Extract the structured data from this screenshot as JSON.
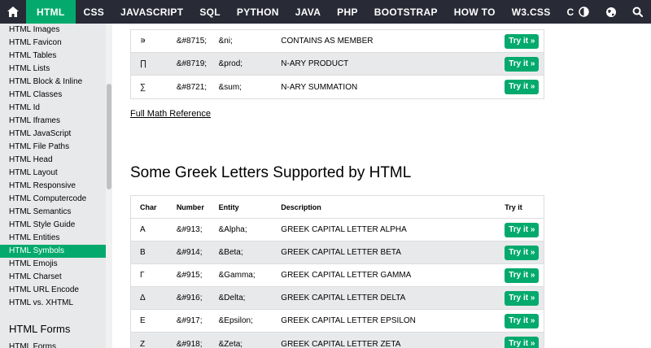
{
  "nav": {
    "items": [
      "HTML",
      "CSS",
      "JAVASCRIPT",
      "SQL",
      "PYTHON",
      "JAVA",
      "PHP",
      "BOOTSTRAP",
      "HOW TO",
      "W3.CSS",
      "C"
    ],
    "active": "HTML",
    "icons": [
      "home-icon",
      "contrast-icon",
      "globe-icon",
      "search-icon"
    ]
  },
  "sidebar": {
    "links": [
      "HTML Images",
      "HTML Favicon",
      "HTML Tables",
      "HTML Lists",
      "HTML Block & Inline",
      "HTML Classes",
      "HTML Id",
      "HTML Iframes",
      "HTML JavaScript",
      "HTML File Paths",
      "HTML Head",
      "HTML Layout",
      "HTML Responsive",
      "HTML Computercode",
      "HTML Semantics",
      "HTML Style Guide",
      "HTML Entities",
      "HTML Symbols",
      "HTML Emojis",
      "HTML Charset",
      "HTML URL Encode",
      "HTML vs. XHTML"
    ],
    "active": "HTML Symbols",
    "section_head": "HTML Forms",
    "section_links": [
      "HTML Forms"
    ]
  },
  "math_table": {
    "rows": [
      {
        "char": "∍",
        "number": "&#8715;",
        "entity": "&ni;",
        "description": "CONTAINS AS MEMBER",
        "try": "Try it »"
      },
      {
        "char": "∏",
        "number": "&#8719;",
        "entity": "&prod;",
        "description": "N-ARY PRODUCT",
        "try": "Try it »"
      },
      {
        "char": "∑",
        "number": "&#8721;",
        "entity": "&sum;",
        "description": "N-ARY SUMMATION",
        "try": "Try it »"
      }
    ]
  },
  "full_math_reference": "Full Math Reference",
  "greek_heading": "Some Greek Letters Supported by HTML",
  "greek_table": {
    "headers": {
      "char": "Char",
      "number": "Number",
      "entity": "Entity",
      "description": "Description",
      "try": "Try it"
    },
    "rows": [
      {
        "char": "Α",
        "number": "&#913;",
        "entity": "&Alpha;",
        "description": "GREEK CAPITAL LETTER ALPHA",
        "try": "Try it »"
      },
      {
        "char": "Β",
        "number": "&#914;",
        "entity": "&Beta;",
        "description": "GREEK CAPITAL LETTER BETA",
        "try": "Try it »"
      },
      {
        "char": "Γ",
        "number": "&#915;",
        "entity": "&Gamma;",
        "description": "GREEK CAPITAL LETTER GAMMA",
        "try": "Try it »"
      },
      {
        "char": "Δ",
        "number": "&#916;",
        "entity": "&Delta;",
        "description": "GREEK CAPITAL LETTER DELTA",
        "try": "Try it »"
      },
      {
        "char": "Ε",
        "number": "&#917;",
        "entity": "&Epsilon;",
        "description": "GREEK CAPITAL LETTER EPSILON",
        "try": "Try it »"
      },
      {
        "char": "Ζ",
        "number": "&#918;",
        "entity": "&Zeta;",
        "description": "GREEK CAPITAL LETTER ZETA",
        "try": "Try it »"
      }
    ]
  },
  "colors": {
    "accent": "#04aa6d",
    "nav_bg": "#282a35",
    "sidebar_bg": "#e7e9eb",
    "alt_row": "#e7e9eb"
  }
}
